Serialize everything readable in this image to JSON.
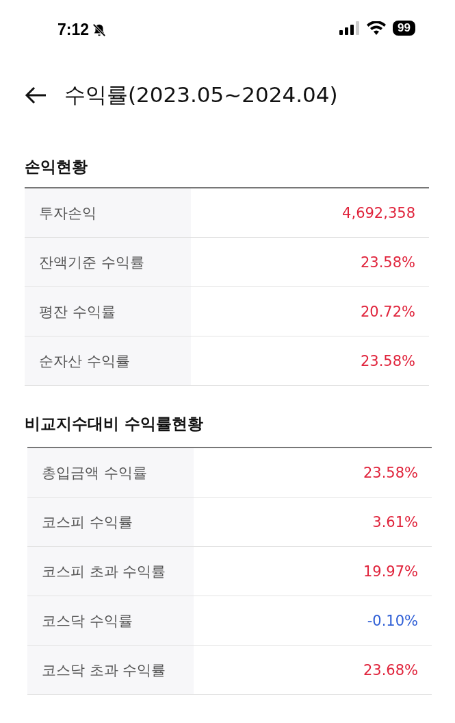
{
  "status_bar": {
    "time": "7:12",
    "battery": "99"
  },
  "header": {
    "title": "수익률(2023.05~2024.04)"
  },
  "sections": [
    {
      "title": "손익현황",
      "rows": [
        {
          "label": "투자손익",
          "value": "4,692,358",
          "color": "#e0233b"
        },
        {
          "label": "잔액기준 수익률",
          "value": "23.58%",
          "color": "#e0233b"
        },
        {
          "label": "평잔 수익률",
          "value": "20.72%",
          "color": "#e0233b"
        },
        {
          "label": "순자산 수익률",
          "value": "23.58%",
          "color": "#e0233b"
        }
      ]
    },
    {
      "title": "비교지수대비 수익률현황",
      "rows": [
        {
          "label": "총입금액 수익률",
          "value": "23.58%",
          "color": "#e0233b"
        },
        {
          "label": "코스피 수익률",
          "value": "3.61%",
          "color": "#e0233b"
        },
        {
          "label": "코스피 초과 수익률",
          "value": "19.97%",
          "color": "#e0233b"
        },
        {
          "label": "코스닥 수익률",
          "value": "-0.10%",
          "color": "#2f5fd6"
        },
        {
          "label": "코스닥 초과 수익률",
          "value": "23.68%",
          "color": "#e0233b"
        }
      ]
    }
  ]
}
